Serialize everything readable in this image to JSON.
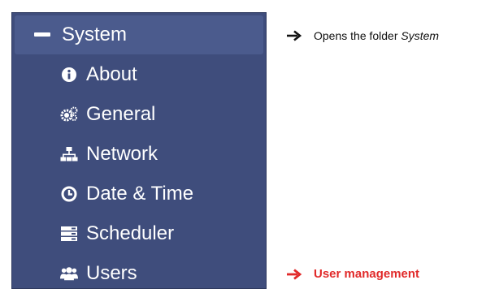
{
  "sidebar": {
    "header": {
      "label": "System",
      "icon": "minus-icon"
    },
    "items": [
      {
        "label": "About",
        "icon": "info-circle-icon"
      },
      {
        "label": "General",
        "icon": "gears-icon"
      },
      {
        "label": "Network",
        "icon": "sitemap-icon"
      },
      {
        "label": "Date & Time",
        "icon": "clock-icon"
      },
      {
        "label": "Scheduler",
        "icon": "server-list-icon"
      },
      {
        "label": "Users",
        "icon": "users-icon"
      }
    ]
  },
  "annotations": {
    "system": {
      "text_prefix": "Opens the folder ",
      "text_emphasis": "System"
    },
    "users": {
      "text": "User management"
    }
  },
  "colors": {
    "sidebar_bg": "#3f4d7c",
    "header_bg": "#4b5b8d",
    "annotation_red": "#e12a2a"
  }
}
